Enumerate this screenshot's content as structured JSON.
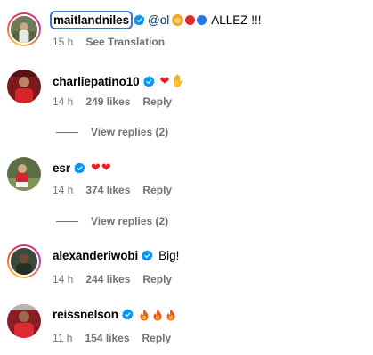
{
  "comments": [
    {
      "username": "maitlandniles",
      "verified": true,
      "mention": "@ol",
      "text_suffix": "ALLEZ !!!",
      "time": "15 h",
      "likes": "",
      "action": "See Translation"
    },
    {
      "username": "charliepatino10",
      "verified": true,
      "text": "",
      "time": "14 h",
      "likes": "249 likes",
      "action": "Reply",
      "view_replies": "View replies (2)"
    },
    {
      "username": "esr",
      "verified": true,
      "text": "",
      "time": "14 h",
      "likes": "374 likes",
      "action": "Reply",
      "view_replies": "View replies (2)"
    },
    {
      "username": "alexanderiwobi",
      "verified": true,
      "text": "Big!",
      "time": "14 h",
      "likes": "244 likes",
      "action": "Reply"
    },
    {
      "username": "reissnelson",
      "verified": true,
      "text": "",
      "time": "11 h",
      "likes": "154 likes",
      "action": "Reply"
    }
  ],
  "colors": {
    "verified_badge": "#0095f6",
    "meta_text": "#737373",
    "mention": "#00376b",
    "focus_outline": "#3d74c8"
  },
  "icons": [
    "verified-badge-icon",
    "heart-emoji",
    "fire-emoji",
    "lion-emoji",
    "raising-hands-emoji",
    "red-circle-emoji",
    "blue-circle-emoji"
  ]
}
